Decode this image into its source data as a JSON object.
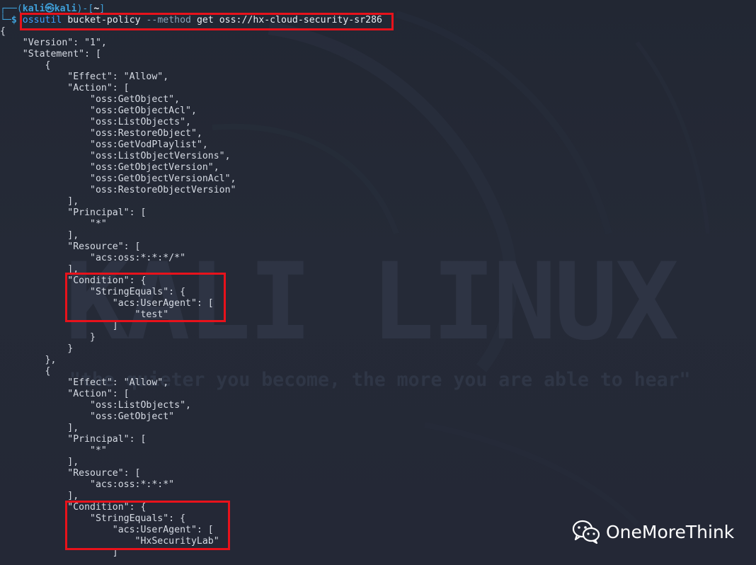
{
  "terminal": {
    "prompt": {
      "open": "┌──(",
      "user": "kali㉿kali",
      "mid": ")-[",
      "cwd": "~",
      "close": "]",
      "second_prefix": "└─",
      "dollar": "$"
    },
    "command": {
      "tool": "ossutil",
      "args1": " bucket-policy ",
      "flag": "--method",
      "args2": " get oss://hx-cloud-security-sr286"
    },
    "output_lines": [
      "{",
      "    \"Version\": \"1\",",
      "    \"Statement\": [",
      "        {",
      "            \"Effect\": \"Allow\",",
      "            \"Action\": [",
      "                \"oss:GetObject\",",
      "                \"oss:GetObjectAcl\",",
      "                \"oss:ListObjects\",",
      "                \"oss:RestoreObject\",",
      "                \"oss:GetVodPlaylist\",",
      "                \"oss:ListObjectVersions\",",
      "                \"oss:GetObjectVersion\",",
      "                \"oss:GetObjectVersionAcl\",",
      "                \"oss:RestoreObjectVersion\"",
      "            ],",
      "            \"Principal\": [",
      "                \"*\"",
      "            ],",
      "            \"Resource\": [",
      "                \"acs:oss:*:*:*/*\"",
      "            ],",
      "            \"Condition\": {",
      "                \"StringEquals\": {",
      "                    \"acs:UserAgent\": [",
      "                        \"test\"",
      "                    ]",
      "                }",
      "            }",
      "        },",
      "        {",
      "            \"Effect\": \"Allow\",",
      "            \"Action\": [",
      "                \"oss:ListObjects\",",
      "                \"oss:GetObject\"",
      "            ],",
      "            \"Principal\": [",
      "                \"*\"",
      "            ],",
      "            \"Resource\": [",
      "                \"acs:oss:*:*:*\"",
      "            ],",
      "            \"Condition\": {",
      "                \"StringEquals\": {",
      "                    \"acs:UserAgent\": [",
      "                        \"HxSecurityLab\"",
      "                    ]"
    ]
  },
  "wallpaper": {
    "title": "KALI LINUX",
    "tagline": "\"the quieter you become, the more you are able to hear\""
  },
  "brand": {
    "name": "OneMoreThink",
    "icon": "wechat-icon"
  },
  "colors": {
    "background": "#242936",
    "prompt_blue": "#3f9fd8",
    "highlight_red": "#e8121b",
    "text": "#d6dbe4"
  }
}
